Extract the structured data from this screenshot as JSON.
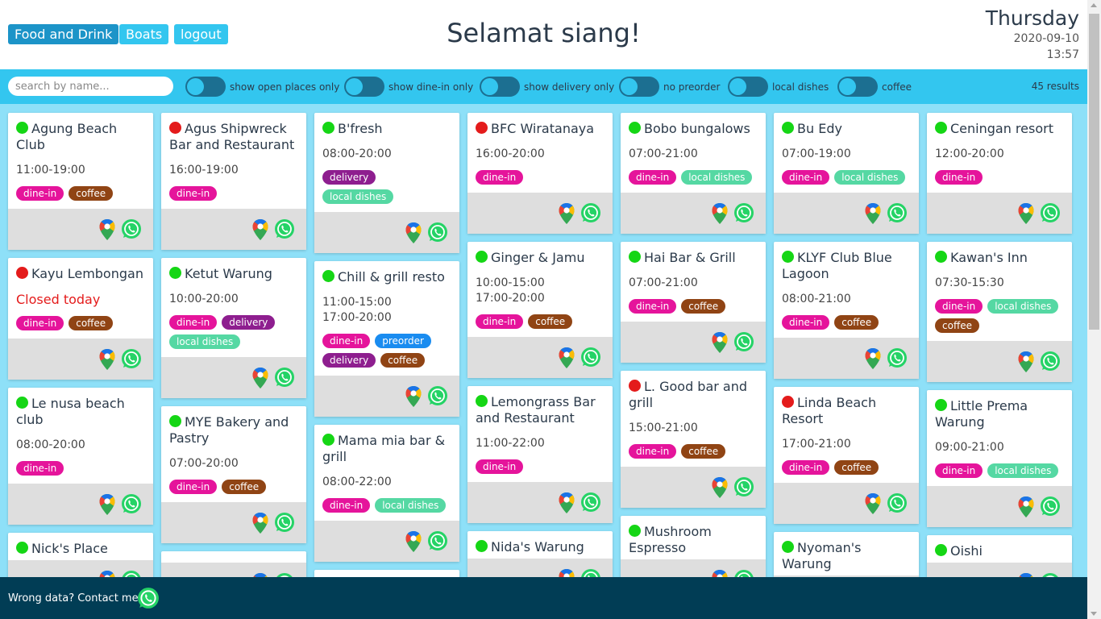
{
  "nav": {
    "food_label": "Food and Drink",
    "boats_label": "Boats",
    "logout_label": "logout"
  },
  "greeting": "Selamat siang!",
  "datetime": {
    "day": "Thursday",
    "date": "2020-09-10",
    "time": "13:57"
  },
  "search": {
    "placeholder": "search by name...",
    "value": ""
  },
  "filters": [
    {
      "label": "show open places only",
      "on": false
    },
    {
      "label": "show dine-in only",
      "on": false
    },
    {
      "label": "show delivery only",
      "on": false
    },
    {
      "label": "no preorder",
      "on": false
    },
    {
      "label": "local dishes",
      "on": false
    },
    {
      "label": "coffee",
      "on": false
    }
  ],
  "results": "45 results",
  "colors": {
    "open": "#15d615",
    "closed": "#e41b1b",
    "dine-in": "#e5149b",
    "coffee": "#904414",
    "delivery": "#8e1e8f",
    "local dishes": "#55d8a3",
    "preorder": "#1a8cf0"
  },
  "columns": [
    [
      {
        "name": "Agung Beach Club",
        "open": true,
        "hours": [
          "11:00-19:00"
        ],
        "tags": [
          "dine-in",
          "coffee"
        ]
      },
      {
        "name": "Kayu Lembongan",
        "open": false,
        "hours": [],
        "closed_text": "Closed today",
        "tags": [
          "dine-in",
          "coffee"
        ]
      },
      {
        "name": "Le nusa beach club",
        "open": true,
        "hours": [
          "08:00-20:00"
        ],
        "tags": [
          "dine-in"
        ]
      },
      {
        "name": "Nick's Place",
        "open": true,
        "hours": [],
        "tags": []
      }
    ],
    [
      {
        "name": "Agus Shipwreck Bar and Restaurant",
        "open": false,
        "hours": [
          "16:00-19:00"
        ],
        "tags": [
          "dine-in"
        ]
      },
      {
        "name": "Ketut Warung",
        "open": true,
        "hours": [
          "10:00-20:00"
        ],
        "tags": [
          "dine-in",
          "delivery",
          "local dishes"
        ]
      },
      {
        "name": "MYE Bakery and Pastry",
        "open": true,
        "hours": [
          "07:00-20:00"
        ],
        "tags": [
          "dine-in",
          "coffee"
        ]
      },
      {
        "name": "",
        "open": null,
        "hours": [],
        "tags": []
      }
    ],
    [
      {
        "name": "B'fresh",
        "open": true,
        "hours": [
          "08:00-20:00"
        ],
        "tags": [
          "delivery",
          "local dishes"
        ]
      },
      {
        "name": "Chill & grill resto",
        "open": true,
        "hours": [
          "11:00-15:00",
          "17:00-20:00"
        ],
        "tags": [
          "dine-in",
          "preorder",
          "delivery",
          "coffee"
        ]
      },
      {
        "name": "Mama mia bar & grill",
        "open": true,
        "hours": [
          "08:00-22:00"
        ],
        "tags": [
          "dine-in",
          "local dishes"
        ]
      },
      {
        "name": "",
        "open": null,
        "hours": [],
        "tags": []
      }
    ],
    [
      {
        "name": "BFC Wiratanaya",
        "open": false,
        "hours": [
          "16:00-20:00"
        ],
        "tags": [
          "dine-in"
        ]
      },
      {
        "name": "Ginger & Jamu",
        "open": true,
        "hours": [
          "10:00-15:00",
          "17:00-20:00"
        ],
        "tags": [
          "dine-in",
          "coffee"
        ]
      },
      {
        "name": "Lemongrass Bar and Restaurant",
        "open": true,
        "hours": [
          "11:00-22:00"
        ],
        "tags": [
          "dine-in"
        ]
      },
      {
        "name": "Nida's Warung",
        "open": true,
        "hours": [],
        "tags": []
      }
    ],
    [
      {
        "name": "Bobo bungalows",
        "open": true,
        "hours": [
          "07:00-21:00"
        ],
        "tags": [
          "dine-in",
          "local dishes"
        ]
      },
      {
        "name": "Hai Bar & Grill",
        "open": true,
        "hours": [
          "07:00-21:00"
        ],
        "tags": [
          "dine-in",
          "coffee"
        ]
      },
      {
        "name": "L. Good bar and grill",
        "open": false,
        "hours": [
          "15:00-21:00"
        ],
        "tags": [
          "dine-in",
          "coffee"
        ]
      },
      {
        "name": "Mushroom Espresso",
        "open": true,
        "hours": [],
        "tags": []
      }
    ],
    [
      {
        "name": "Bu Edy",
        "open": true,
        "hours": [
          "07:00-19:00"
        ],
        "tags": [
          "dine-in",
          "local dishes"
        ]
      },
      {
        "name": "KLYF Club Blue Lagoon",
        "open": true,
        "hours": [
          "08:00-21:00"
        ],
        "tags": [
          "dine-in",
          "coffee"
        ]
      },
      {
        "name": "Linda Beach Resort",
        "open": false,
        "hours": [
          "17:00-21:00"
        ],
        "tags": [
          "dine-in",
          "coffee"
        ]
      },
      {
        "name": "Nyoman's Warung",
        "open": true,
        "hours": [],
        "tags": []
      }
    ],
    [
      {
        "name": "Ceningan resort",
        "open": true,
        "hours": [
          "12:00-20:00"
        ],
        "tags": [
          "dine-in"
        ]
      },
      {
        "name": "Kawan's Inn",
        "open": true,
        "hours": [
          "07:30-15:30"
        ],
        "tags": [
          "dine-in",
          "local dishes",
          "coffee"
        ]
      },
      {
        "name": "Little Prema Warung",
        "open": true,
        "hours": [
          "09:00-21:00"
        ],
        "tags": [
          "dine-in",
          "local dishes"
        ]
      },
      {
        "name": "Oishi",
        "open": true,
        "hours": [],
        "tags": []
      }
    ]
  ],
  "footer": {
    "text": "Wrong data? Contact me on:"
  }
}
